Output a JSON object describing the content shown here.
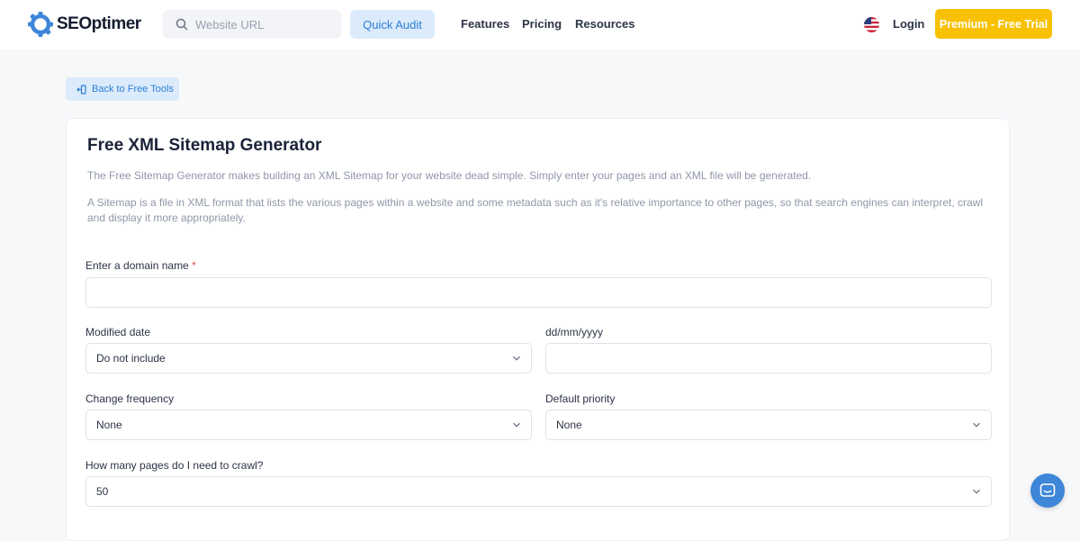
{
  "header": {
    "logo_text": "SEOptimer",
    "search_placeholder": "Website URL",
    "quick_audit_label": "Quick Audit",
    "nav": [
      "Features",
      "Pricing",
      "Resources"
    ],
    "login_label": "Login",
    "premium_label": "Premium - Free Trial"
  },
  "back_label": "Back to Free Tools",
  "card": {
    "title": "Free XML Sitemap Generator",
    "desc1": "The Free Sitemap Generator makes building an XML Sitemap for your website dead simple. Simply enter your pages and an XML file will be generated.",
    "desc2": "A Sitemap is a file in XML format that lists the various pages within a website and some metadata such as it's relative importance to other pages, so that search engines can interpret, crawl and display it more appropriately."
  },
  "form": {
    "domain_label": "Enter a domain name",
    "domain_required": "*",
    "domain_value": "",
    "modified_label": "Modified date",
    "modified_value": "Do not include",
    "date_label": "dd/mm/yyyy",
    "date_value": "",
    "frequency_label": "Change frequency",
    "frequency_value": "None",
    "priority_label": "Default priority",
    "priority_value": "None",
    "pages_label": "How many pages do I need to crawl?",
    "pages_value": "50"
  },
  "colors": {
    "accent": "#2b7fd6",
    "accent_light": "#dcebfb",
    "premium": "#f8c104",
    "chat": "#3d86d8"
  },
  "icons": [
    "seoptimer-logo-icon",
    "search-icon",
    "us-flag-icon",
    "back-icon",
    "chevron-down-icon",
    "chat-icon"
  ]
}
